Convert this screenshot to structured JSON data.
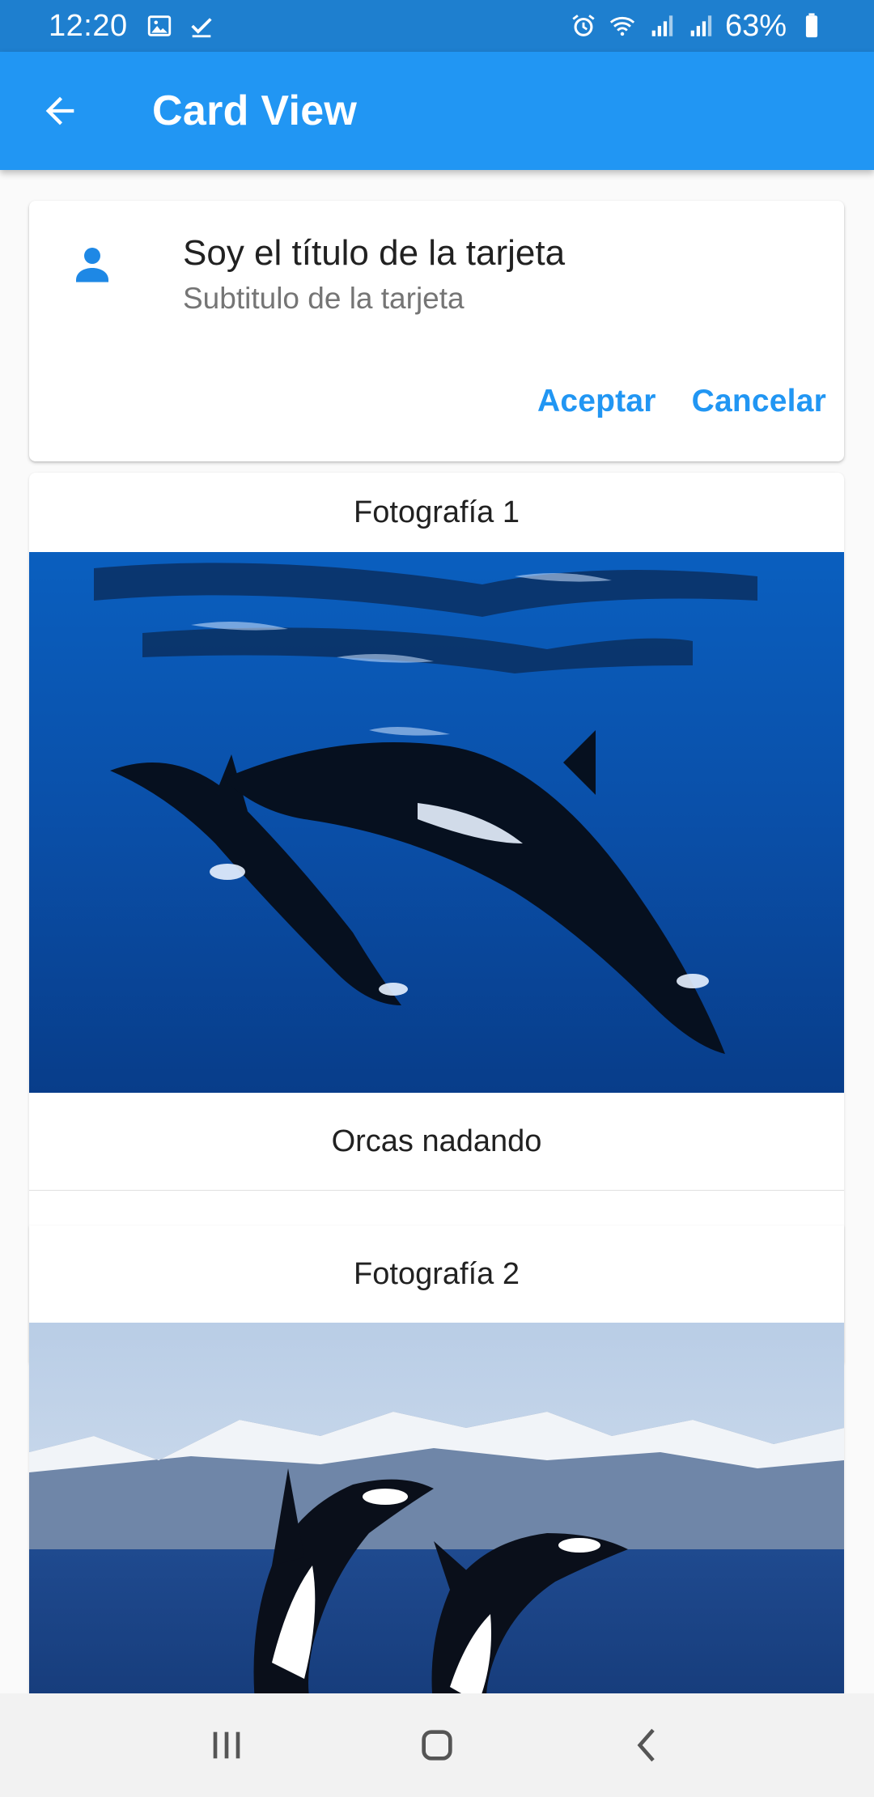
{
  "status_bar": {
    "time": "12:20",
    "battery_percent": "63%",
    "icons": [
      "image-icon",
      "check-icon",
      "alarm-icon",
      "wifi-icon",
      "signal-icon",
      "signal-icon",
      "battery-icon"
    ]
  },
  "app_bar": {
    "title": "Card View",
    "back_icon": "arrow-back-icon",
    "color": "#2196f3"
  },
  "card": {
    "title": "Soy el título de la tarjeta",
    "subtitle": "Subtitulo de la tarjeta",
    "icon": "person-icon",
    "actions": {
      "accept": "Aceptar",
      "cancel": "Cancelar"
    }
  },
  "photos": [
    {
      "title": "Fotografía 1",
      "caption": "Orcas nadando"
    },
    {
      "title": "Fotografía 2"
    }
  ],
  "nav_bar": {
    "icons": [
      "recent-apps-icon",
      "home-icon",
      "back-icon"
    ]
  }
}
